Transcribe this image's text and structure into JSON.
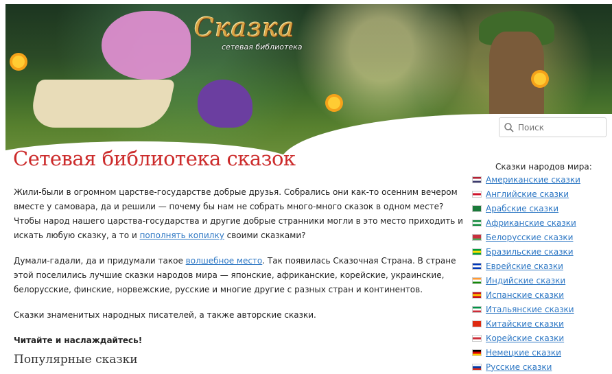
{
  "banner": {
    "logo_title": "Сказка",
    "logo_subtitle": "сетевая библиотека"
  },
  "search": {
    "placeholder": "Поиск"
  },
  "page_title": "Сетевая библиотека сказок",
  "content": {
    "p1_before": "Жили-были в огромном царстве-государстве добрые друзья. Собрались они как-то осенним вечером вместе у самовара, да и решили — почему бы нам не собрать много-много сказок в одном месте? Чтобы народ нашего царства-государства и другие добрые странники могли в это место приходить и искать любую сказку, а то и ",
    "p1_link": "пополнять копилку",
    "p1_after": " своими сказками?",
    "p2_before": "Думали-гадали, да и придумали такое ",
    "p2_link": "волшебное место",
    "p2_after": ". Так появилась Сказочная Страна. В стране этой поселились лучшие сказки народов мира — японские, африканские, корейские, украинские, белорусские, финские, норвежские, русские и многие другие с разных стран и континентов.",
    "p3": "Сказки знаменитых народных писателей, а также авторские сказки.",
    "p4": "Читайте и наслаждайтесь!"
  },
  "popular_heading": "Популярные сказки",
  "sidebar": {
    "title": "Сказки народов мира:",
    "items": [
      {
        "label": "Американские сказки",
        "flag": [
          "#b22234",
          "#ffffff",
          "#3c3b6e"
        ]
      },
      {
        "label": "Английские сказки",
        "flag": [
          "#ffffff",
          "#cf142b",
          "#ffffff"
        ]
      },
      {
        "label": "Арабские сказки",
        "flag": [
          "#1a7a3a",
          "#1a7a3a",
          "#1a7a3a"
        ]
      },
      {
        "label": "Африканские сказки",
        "flag": [
          "#0f8a3a",
          "#ffffff",
          "#0f8a3a"
        ]
      },
      {
        "label": "Белорусские сказки",
        "flag": [
          "#c8313e",
          "#c8313e",
          "#4aa657"
        ]
      },
      {
        "label": "Бразильские сказки",
        "flag": [
          "#009c3b",
          "#ffdf00",
          "#009c3b"
        ]
      },
      {
        "label": "Еврейские сказки",
        "flag": [
          "#0038b8",
          "#ffffff",
          "#0038b8"
        ]
      },
      {
        "label": "Индийские сказки",
        "flag": [
          "#ff9933",
          "#ffffff",
          "#138808"
        ]
      },
      {
        "label": "Испанские сказки",
        "flag": [
          "#c60b1e",
          "#ffc400",
          "#c60b1e"
        ]
      },
      {
        "label": "Итальянские сказки",
        "flag": [
          "#009246",
          "#ffffff",
          "#ce2b37"
        ]
      },
      {
        "label": "Китайские сказки",
        "flag": [
          "#de2910",
          "#de2910",
          "#de2910"
        ]
      },
      {
        "label": "Корейские сказки",
        "flag": [
          "#ffffff",
          "#cd2e3a",
          "#ffffff"
        ]
      },
      {
        "label": "Немецкие сказки",
        "flag": [
          "#000000",
          "#dd0000",
          "#ffce00"
        ]
      },
      {
        "label": "Русские сказки",
        "flag": [
          "#ffffff",
          "#0039a6",
          "#d52b1e"
        ]
      }
    ]
  }
}
